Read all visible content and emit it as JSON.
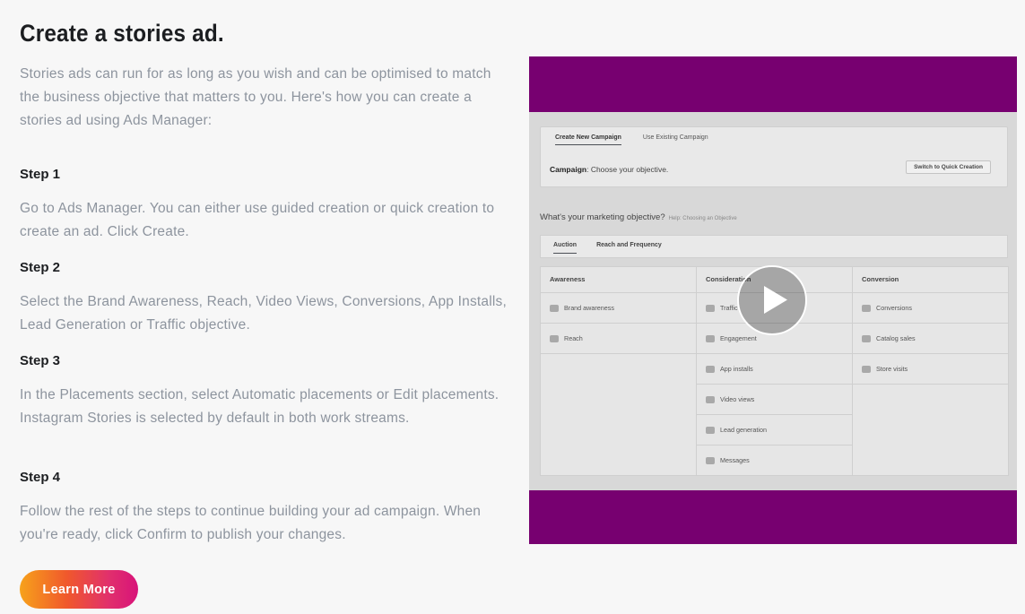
{
  "title": "Create a stories ad.",
  "intro": "Stories ads can run for as long as you wish and can be optimised to match the business objective that matters to you. Here's how you can create a stories ad using Ads Manager:",
  "steps": [
    {
      "label": "Step 1",
      "text": "Go to Ads Manager. You can either use guided creation or quick creation to create an ad. Click Create."
    },
    {
      "label": "Step 2",
      "text": "Select the Brand Awareness, Reach, Video Views, Conversions, App Installs, Lead Generation or Traffic objective."
    },
    {
      "label": "Step 3",
      "text": "In the Placements section, select Automatic placements or Edit placements. Instagram Stories is selected by default in both work streams."
    },
    {
      "label": "Step 4",
      "text": "Follow the rest of the steps to continue building your ad campaign. When you're ready, click Confirm to publish your changes."
    }
  ],
  "cta": {
    "label": "Learn More"
  },
  "video": {
    "border_color": "#770070",
    "tabs": [
      "Create New Campaign",
      "Use Existing Campaign"
    ],
    "campaign_label": "Campaign",
    "campaign_text": ": Choose your objective.",
    "quick_button": "Switch to Quick Creation",
    "objective_question": "What's your marketing objective?",
    "objective_help": "Help: Choosing an Objective",
    "buying_tabs": [
      "Auction",
      "Reach and Frequency"
    ],
    "columns": [
      {
        "head": "Awareness",
        "items": [
          "Brand awareness",
          "Reach"
        ]
      },
      {
        "head": "Consideration",
        "items": [
          "Traffic",
          "Engagement",
          "App installs",
          "Video views",
          "Lead generation",
          "Messages"
        ]
      },
      {
        "head": "Conversion",
        "items": [
          "Conversions",
          "Catalog sales",
          "Store visits"
        ]
      }
    ],
    "play_icon": "play-icon"
  }
}
